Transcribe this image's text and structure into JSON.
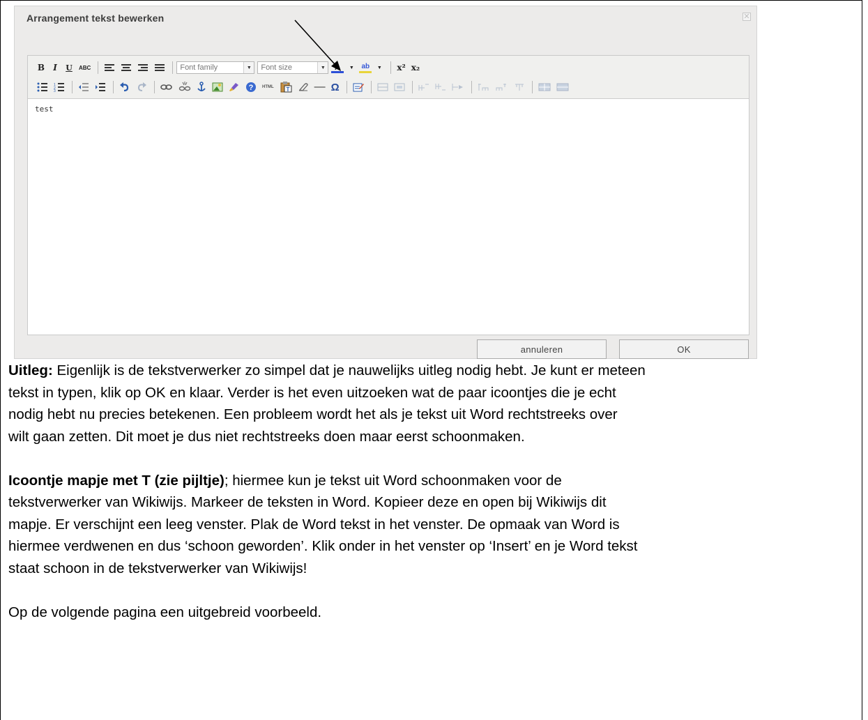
{
  "dialog": {
    "title": "Arrangement tekst bewerken",
    "close_glyph": "✕",
    "editor_content": "test",
    "toolbar": {
      "bold": "B",
      "italic": "I",
      "underline": "U",
      "strike": "ABC",
      "font_family": "Font family",
      "font_size": "Font size",
      "font_color": "A",
      "highlight": "ab",
      "superscript": "x²",
      "subscript": "x₂",
      "html_btn": "HTML",
      "hr": "—",
      "omega": "Ω"
    },
    "buttons": {
      "cancel": "annuleren",
      "ok": "OK"
    }
  },
  "text": {
    "p1_bold": "Uitleg:",
    "p1_lines": [
      " Eigenlijk is de tekstverwerker zo simpel dat je nauwelijks uitleg nodig hebt. Je kunt er meteen",
      "tekst in typen, klik op OK en klaar. Verder is het even uitzoeken wat de paar icoontjes die je echt",
      "nodig hebt nu precies betekenen.  Een probleem wordt het als je tekst uit Word rechtstreeks over",
      "wilt gaan zetten. Dit moet je dus niet rechtstreeks doen maar eerst schoonmaken."
    ],
    "p2_bold": "Icoontje mapje met T (zie pijltje)",
    "p2_lines": [
      "; hiermee kun je tekst uit Word schoonmaken voor de",
      "tekstverwerker van Wikiwijs. Markeer de teksten in Word. Kopieer deze en open bij Wikiwijs dit",
      "mapje. Er verschijnt een leeg venster. Plak de Word tekst in het  venster. De opmaak van Word is",
      "hiermee verdwenen en dus ‘schoon geworden’. Klik onder in het venster op ‘Insert’ en je Word tekst",
      "staat schoon in de tekstverwerker van Wikiwijs!"
    ],
    "p3": "Op de volgende pagina een uitgebreid voorbeeld."
  }
}
